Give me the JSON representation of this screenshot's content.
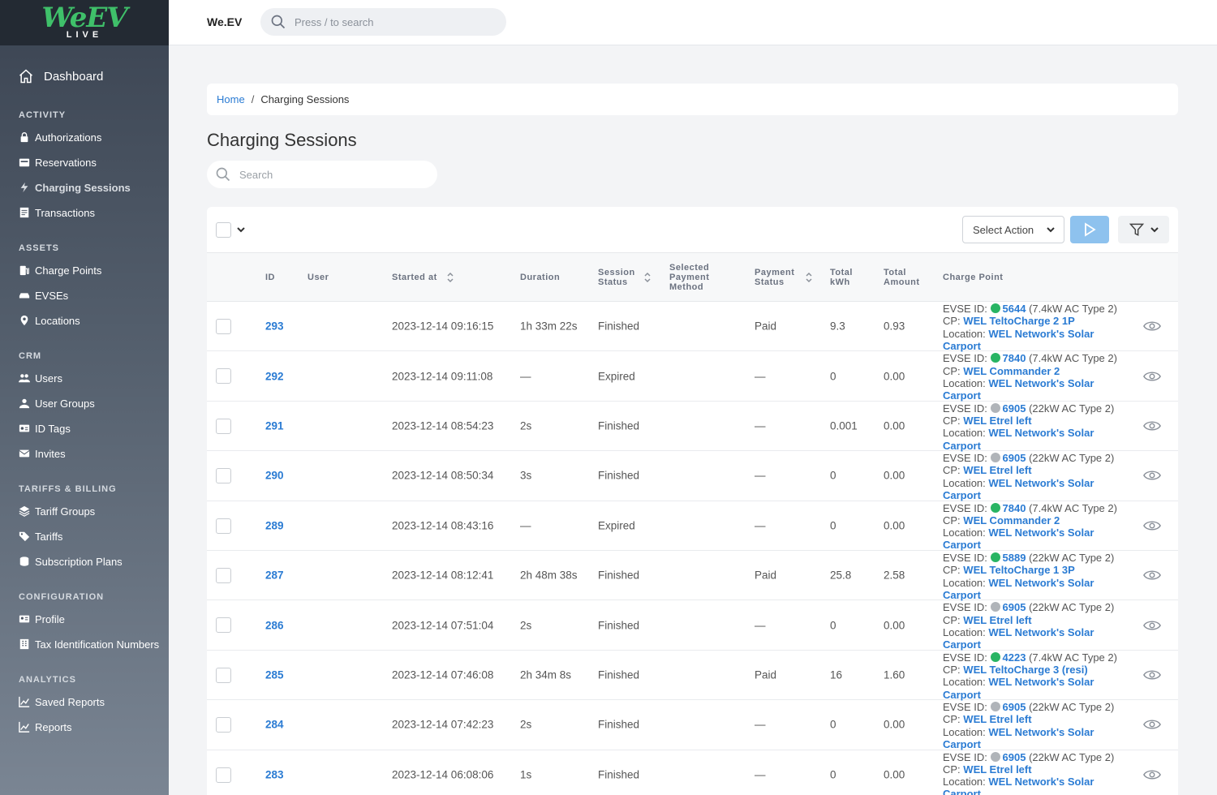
{
  "logo": {
    "main": "WeEV",
    "sub": "LIVE"
  },
  "sidebar": {
    "dashboard": "Dashboard",
    "sections": [
      {
        "title": "ACTIVITY",
        "items": [
          {
            "label": "Authorizations",
            "icon": "lock-icon"
          },
          {
            "label": "Reservations",
            "icon": "calendar-icon"
          },
          {
            "label": "Charging Sessions",
            "icon": "bolt-icon",
            "active": true
          },
          {
            "label": "Transactions",
            "icon": "receipt-icon"
          }
        ]
      },
      {
        "title": "ASSETS",
        "items": [
          {
            "label": "Charge Points",
            "icon": "charger-icon"
          },
          {
            "label": "EVSEs",
            "icon": "car-icon"
          },
          {
            "label": "Locations",
            "icon": "map-pin-icon"
          }
        ]
      },
      {
        "title": "CRM",
        "items": [
          {
            "label": "Users",
            "icon": "users-icon"
          },
          {
            "label": "User Groups",
            "icon": "user-group-icon"
          },
          {
            "label": "ID Tags",
            "icon": "id-card-icon"
          },
          {
            "label": "Invites",
            "icon": "envelope-icon"
          }
        ]
      },
      {
        "title": "TARIFFS & BILLING",
        "items": [
          {
            "label": "Tariff Groups",
            "icon": "layers-icon"
          },
          {
            "label": "Tariffs",
            "icon": "tag-icon"
          },
          {
            "label": "Subscription Plans",
            "icon": "coins-icon"
          }
        ]
      },
      {
        "title": "CONFIGURATION",
        "items": [
          {
            "label": "Profile",
            "icon": "profile-card-icon"
          },
          {
            "label": "Tax Identification Numbers",
            "icon": "building-icon"
          }
        ]
      },
      {
        "title": "ANALYTICS",
        "items": [
          {
            "label": "Saved Reports",
            "icon": "chart-icon"
          },
          {
            "label": "Reports",
            "icon": "chart-icon"
          }
        ]
      }
    ]
  },
  "topbar": {
    "brand": "We.EV",
    "search_placeholder": "Press / to search"
  },
  "breadcrumb": {
    "home": "Home",
    "sep": "/",
    "current": "Charging Sessions"
  },
  "page": {
    "title": "Charging Sessions",
    "search_placeholder": "Search"
  },
  "toolbar": {
    "select_action": "Select Action"
  },
  "columns": {
    "id": "ID",
    "user": "User",
    "started_at": "Started at",
    "duration": "Duration",
    "session_status_1": "Session",
    "session_status_2": "Status",
    "payment_method_1": "Selected",
    "payment_method_2": "Payment",
    "payment_method_3": "Method",
    "payment_status_1": "Payment",
    "payment_status_2": "Status",
    "total_kwh_1": "Total",
    "total_kwh_2": "kWh",
    "total_amount_1": "Total",
    "total_amount_2": "Amount",
    "charge_point": "Charge Point"
  },
  "labels": {
    "evse_id": "EVSE ID:",
    "cp": "CP:",
    "location": "Location:"
  },
  "status_colors": {
    "green": "#28b463",
    "gray": "#b0b4b9"
  },
  "rows": [
    {
      "id": "293",
      "started": "2023-12-14 09:16:15",
      "duration": "1h 33m 22s",
      "status": "Finished",
      "payment_status": "Paid",
      "kwh": "9.3",
      "amount": "0.93",
      "evse": "5644",
      "evse_color": "#28b463",
      "evse_type": "(7.4kW AC Type 2)",
      "cp": "WEL TeltoCharge 2 1P",
      "location_1": "WEL Network's Solar",
      "location_2": "Carport"
    },
    {
      "id": "292",
      "started": "2023-12-14 09:11:08",
      "duration": "—",
      "status": "Expired",
      "payment_status": "—",
      "kwh": "0",
      "amount": "0.00",
      "evse": "7840",
      "evse_color": "#28b463",
      "evse_type": "(7.4kW AC Type 2)",
      "cp": "WEL Commander 2",
      "location_1": "WEL Network's Solar",
      "location_2": "Carport"
    },
    {
      "id": "291",
      "started": "2023-12-14 08:54:23",
      "duration": "2s",
      "status": "Finished",
      "payment_status": "—",
      "kwh": "0.001",
      "amount": "0.00",
      "evse": "6905",
      "evse_color": "#b0b4b9",
      "evse_type": "(22kW AC Type 2)",
      "cp": "WEL Etrel left",
      "location_1": "WEL Network's Solar",
      "location_2": "Carport"
    },
    {
      "id": "290",
      "started": "2023-12-14 08:50:34",
      "duration": "3s",
      "status": "Finished",
      "payment_status": "—",
      "kwh": "0",
      "amount": "0.00",
      "evse": "6905",
      "evse_color": "#b0b4b9",
      "evse_type": "(22kW AC Type 2)",
      "cp": "WEL Etrel left",
      "location_1": "WEL Network's Solar",
      "location_2": "Carport"
    },
    {
      "id": "289",
      "started": "2023-12-14 08:43:16",
      "duration": "—",
      "status": "Expired",
      "payment_status": "—",
      "kwh": "0",
      "amount": "0.00",
      "evse": "7840",
      "evse_color": "#28b463",
      "evse_type": "(7.4kW AC Type 2)",
      "cp": "WEL Commander 2",
      "location_1": "WEL Network's Solar",
      "location_2": "Carport"
    },
    {
      "id": "287",
      "started": "2023-12-14 08:12:41",
      "duration": "2h 48m 38s",
      "status": "Finished",
      "payment_status": "Paid",
      "kwh": "25.8",
      "amount": "2.58",
      "evse": "5889",
      "evse_color": "#28b463",
      "evse_type": "(22kW AC Type 2)",
      "cp": "WEL TeltoCharge 1 3P",
      "location_1": "WEL Network's Solar",
      "location_2": "Carport"
    },
    {
      "id": "286",
      "started": "2023-12-14 07:51:04",
      "duration": "2s",
      "status": "Finished",
      "payment_status": "—",
      "kwh": "0",
      "amount": "0.00",
      "evse": "6905",
      "evse_color": "#b0b4b9",
      "evse_type": "(22kW AC Type 2)",
      "cp": "WEL Etrel left",
      "location_1": "WEL Network's Solar",
      "location_2": "Carport"
    },
    {
      "id": "285",
      "started": "2023-12-14 07:46:08",
      "duration": "2h 34m 8s",
      "status": "Finished",
      "payment_status": "Paid",
      "kwh": "16",
      "amount": "1.60",
      "evse": "4223",
      "evse_color": "#28b463",
      "evse_type": "(7.4kW AC Type 2)",
      "cp": "WEL TeltoCharge 3 (resi)",
      "location_1": "WEL Network's Solar",
      "location_2": "Carport"
    },
    {
      "id": "284",
      "started": "2023-12-14 07:42:23",
      "duration": "2s",
      "status": "Finished",
      "payment_status": "—",
      "kwh": "0",
      "amount": "0.00",
      "evse": "6905",
      "evse_color": "#b0b4b9",
      "evse_type": "(22kW AC Type 2)",
      "cp": "WEL Etrel left",
      "location_1": "WEL Network's Solar",
      "location_2": "Carport"
    },
    {
      "id": "283",
      "started": "2023-12-14 06:08:06",
      "duration": "1s",
      "status": "Finished",
      "payment_status": "—",
      "kwh": "0",
      "amount": "0.00",
      "evse": "6905",
      "evse_color": "#b0b4b9",
      "evse_type": "(22kW AC Type 2)",
      "cp": "WEL Etrel left",
      "location_1": "WEL Network's Solar",
      "location_2": "Carport"
    }
  ]
}
